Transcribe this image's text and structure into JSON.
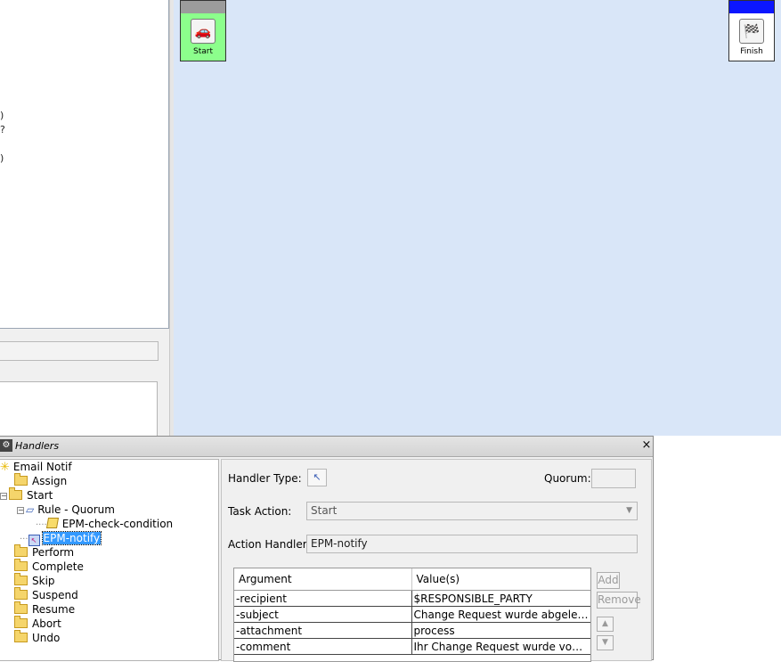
{
  "left_panel": {
    "fragments": [
      ")",
      "?",
      ")"
    ]
  },
  "canvas": {
    "start_node": {
      "label": "Start",
      "icon": "car-icon"
    },
    "finish_node": {
      "label": "Finish",
      "icon": "checkered-flag-car-icon"
    }
  },
  "dialog": {
    "title": "Handlers",
    "close_glyph": "×",
    "tree": {
      "root": "Email Notif",
      "items": [
        "Assign",
        "Start",
        "Rule - Quorum",
        "EPM-check-condition",
        "EPM-notify",
        "Perform",
        "Complete",
        "Skip",
        "Suspend",
        "Resume",
        "Abort",
        "Undo"
      ]
    },
    "props": {
      "handler_type_label": "Handler Type:",
      "quorum_label": "Quorum:",
      "quorum_value": "",
      "task_action_label": "Task Action:",
      "task_action_value": "Start",
      "action_handler_label": "Action Handler:",
      "action_handler_value": "EPM-notify",
      "columns": [
        "Argument",
        "Value(s)"
      ],
      "rows": [
        {
          "argument": "-recipient",
          "value": "$RESPONSIBLE_PARTY"
        },
        {
          "argument": "-subject",
          "value": "Change Request wurde abgelehnt"
        },
        {
          "argument": "-attachment",
          "value": "process"
        },
        {
          "argument": "-comment",
          "value": "Ihr Change Request wurde von der ..."
        }
      ],
      "add_label": "Add",
      "remove_label": "Remove"
    }
  },
  "colors": {
    "canvas_bg": "#d9e6f8",
    "start_node_bg": "#8cff8c",
    "finish_band": "#0b16ff",
    "selection": "#3399ff"
  }
}
